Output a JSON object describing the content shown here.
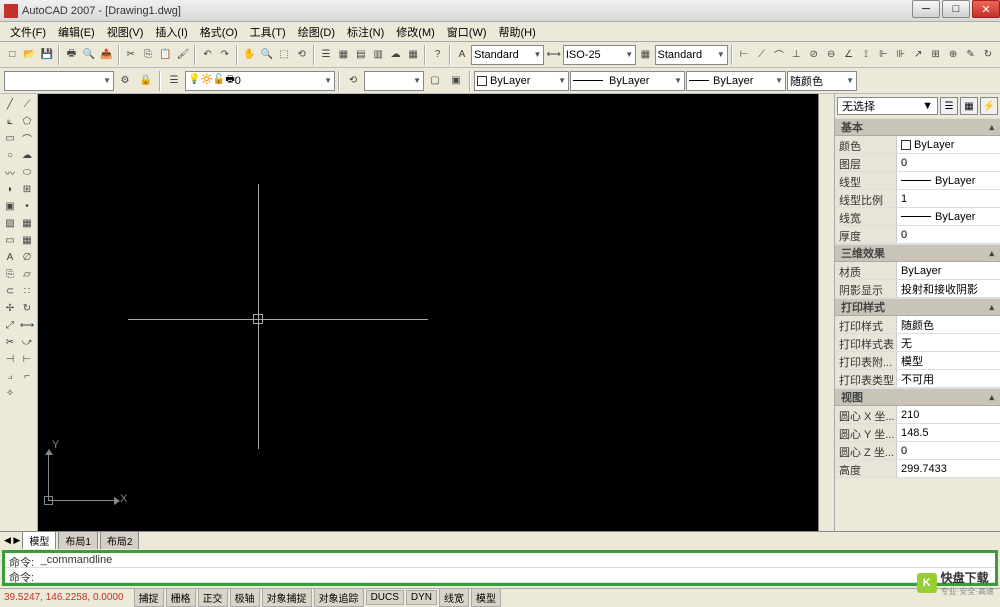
{
  "title": "AutoCAD 2007 - [Drawing1.dwg]",
  "menus": [
    "文件(F)",
    "编辑(E)",
    "视图(V)",
    "插入(I)",
    "格式(O)",
    "工具(T)",
    "绘图(D)",
    "标注(N)",
    "修改(M)",
    "窗口(W)",
    "帮助(H)"
  ],
  "styles_row": {
    "text_style": "Standard",
    "dim_style": "ISO-25",
    "table_style": "Standard"
  },
  "layer_row": {
    "layer": "0",
    "color": "ByLayer",
    "linetype": "ByLayer",
    "lineweight": "ByLayer",
    "plotcolor": "随颜色"
  },
  "properties": {
    "selection": "无选择",
    "sections": {
      "basic": {
        "title": "基本",
        "rows": [
          {
            "label": "颜色",
            "value": "ByLayer",
            "swatch": true
          },
          {
            "label": "图层",
            "value": "0"
          },
          {
            "label": "线型",
            "value": "ByLayer",
            "line": true
          },
          {
            "label": "线型比例",
            "value": "1"
          },
          {
            "label": "线宽",
            "value": "ByLayer",
            "line": true
          },
          {
            "label": "厚度",
            "value": "0"
          }
        ]
      },
      "threed": {
        "title": "三维效果",
        "rows": [
          {
            "label": "材质",
            "value": "ByLayer"
          },
          {
            "label": "阴影显示",
            "value": "投射和接收阴影"
          }
        ]
      },
      "print": {
        "title": "打印样式",
        "rows": [
          {
            "label": "打印样式",
            "value": "随颜色"
          },
          {
            "label": "打印样式表",
            "value": "无"
          },
          {
            "label": "打印表附...",
            "value": "模型"
          },
          {
            "label": "打印表类型",
            "value": "不可用"
          }
        ]
      },
      "view": {
        "title": "视图",
        "rows": [
          {
            "label": "圆心 X 坐...",
            "value": "210"
          },
          {
            "label": "圆心 Y 坐...",
            "value": "148.5"
          },
          {
            "label": "圆心 Z 坐...",
            "value": "0"
          },
          {
            "label": "高度",
            "value": "299.7433"
          }
        ]
      }
    }
  },
  "tabs": [
    "模型",
    "布局1",
    "布局2"
  ],
  "cmd": {
    "prompt": "命令:",
    "prev": "_commandline"
  },
  "status": {
    "coords": "39.5247, 146.2258, 0.0000",
    "buttons": [
      "捕捉",
      "栅格",
      "正交",
      "极轴",
      "对象捕捉",
      "对象追踪",
      "DUCS",
      "DYN",
      "线宽",
      "模型"
    ]
  },
  "ucs": {
    "x": "X",
    "y": "Y"
  },
  "watermark": {
    "name": "快盘下载",
    "sub": "专业·安全·高速"
  }
}
